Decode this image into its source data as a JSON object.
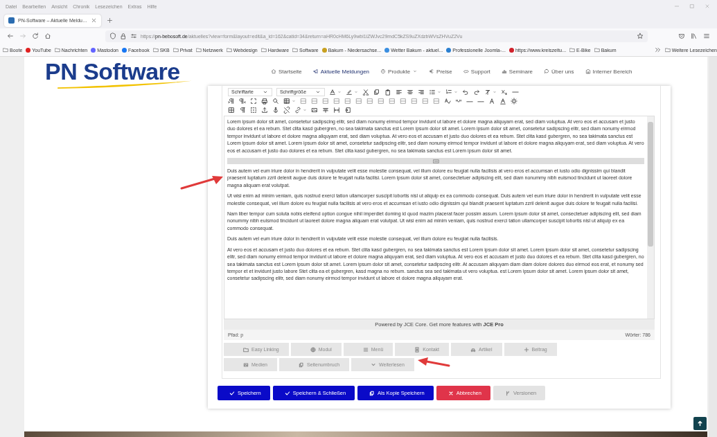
{
  "browser": {
    "menu": [
      "Datei",
      "Bearbeiten",
      "Ansicht",
      "Chronik",
      "Lesezeichen",
      "Extras",
      "Hilfe"
    ],
    "tab": {
      "title": "PN-Software – Aktuelle Meldu…"
    },
    "url": {
      "scheme": "https://",
      "host": "pn-bebosoft.de",
      "path": "/aktuelles?view=form&layout=edit&a_id=162&catid=34&return=aHR0cHM6Ly9wbi1iZWJvc29mdC5kZS9uZXdzbWVsZHVuZ2Vu"
    },
    "bookmarks": [
      {
        "label": "Boote",
        "kind": "folder"
      },
      {
        "label": "YouTube",
        "kind": "favicon",
        "color": "#e02020"
      },
      {
        "label": "Nachrichten",
        "kind": "folder"
      },
      {
        "label": "Mastodon",
        "kind": "favicon",
        "color": "#6364ff"
      },
      {
        "label": "Facebook",
        "kind": "favicon",
        "color": "#1877f2"
      },
      {
        "label": "SKB",
        "kind": "folder"
      },
      {
        "label": "Privat",
        "kind": "folder"
      },
      {
        "label": "Netzwerk",
        "kind": "folder"
      },
      {
        "label": "Webdesign",
        "kind": "folder"
      },
      {
        "label": "Hardware",
        "kind": "folder"
      },
      {
        "label": "Software",
        "kind": "folder"
      },
      {
        "label": "Bakum - Niedersachse...",
        "kind": "favicon",
        "color": "#c8a020"
      },
      {
        "label": "Wetter Bakum - aktuel...",
        "kind": "favicon",
        "color": "#3a8ee0"
      },
      {
        "label": "Professionelle Joomla-...",
        "kind": "favicon",
        "color": "#2a7fd0"
      },
      {
        "label": "https://www.kreiszeitu...",
        "kind": "favicon",
        "color": "#d0202a"
      },
      {
        "label": "E-Bike",
        "kind": "folder"
      },
      {
        "label": "Bakum",
        "kind": "folder"
      }
    ],
    "other_bookmarks": "Weitere Lesezeichen"
  },
  "site": {
    "logo": "PN Software",
    "nav": [
      {
        "label": "Startseite",
        "selected": false,
        "dropdown": false
      },
      {
        "label": "Aktuelle Meldungen",
        "selected": true,
        "dropdown": false
      },
      {
        "label": "Produkte",
        "selected": false,
        "dropdown": true
      },
      {
        "label": "Preise",
        "selected": false,
        "dropdown": false
      },
      {
        "label": "Support",
        "selected": false,
        "dropdown": false
      },
      {
        "label": "Seminare",
        "selected": false,
        "dropdown": false
      },
      {
        "label": "Über uns",
        "selected": false,
        "dropdown": false
      },
      {
        "label": "Interner Bereich",
        "selected": false,
        "dropdown": false
      }
    ]
  },
  "editor": {
    "font_selects": [
      "Schriftarte",
      "Schriftgröße"
    ],
    "content": [
      {
        "kind": "text",
        "text": "Lorem ipsum dolor sit amet, consetetur sadipscing elitr, sed diam nonumy eirmod tempor invidunt ut labore et dolore magna aliquyam erat, sed diam voluptua. At vero eos et accusam et justo duo dolores et ea rebum. Stet clita kasd gubergren, no sea takimata sanctus est Lorem ipsum dolor sit amet. Lorem ipsum dolor sit amet, consetetur sadipscing elitr, sed diam nonumy eirmod tempor invidunt ut labore et dolore magna aliquyam erat, sed diam voluptua. At vero eos et accusam et justo duo dolores et ea rebum. Stet clita kasd gubergren, no sea takimata sanctus est Lorem ipsum dolor sit amet. Lorem ipsum dolor sit amet, consetetur sadipscing elitr, sed diam nonumy eirmod tempor invidunt ut labore et dolore magna aliquyam erat, sed diam voluptua. At vero eos et accusam et justo duo dolores et ea rebum. Stet clita kasd gubergren, no sea takimata sanctus est Lorem ipsum dolor sit amet."
      },
      {
        "kind": "readmore"
      },
      {
        "kind": "text",
        "text": "Duis autem vel eum iriure dolor in hendrerit in vulputate velit esse molestie consequat, vel illum dolore eu feugiat nulla facilisis at vero eros et accumsan et iusto odio dignissim qui blandit praesent luptatum zzril delenit augue duis dolore te feugait nulla facilisi. Lorem ipsum dolor sit amet, consectetuer adipiscing elit, sed diam nonummy nibh euismod tincidunt ut laoreet dolore magna aliquam erat volutpat."
      },
      {
        "kind": "text",
        "text": "Ut wisi enim ad minim veniam, quis nostrud exerci tation ullamcorper suscipit lobortis nisl ut aliquip ex ea commodo consequat. Duis autem vel eum iriure dolor in hendrerit in vulputate velit esse molestie consequat, vel illum dolore eu feugiat nulla facilisis at vero eros et accumsan et iusto odio dignissim qui blandit praesent luptatum zzril delenit augue duis dolore te feugait nulla facilisi."
      },
      {
        "kind": "text",
        "text": "Nam liber tempor cum soluta nobis eleifend option congue nihil imperdiet doming id quod mazim placerat facer possim assum. Lorem ipsum dolor sit amet, consectetuer adipiscing elit, sed diam nonummy nibh euismod tincidunt ut laoreet dolore magna aliquam erat volutpat. Ut wisi enim ad minim veniam, quis nostrud exerci tation ullamcorper suscipit lobortis nisl ut aliquip ex ea commodo consequat."
      },
      {
        "kind": "text",
        "text": "Duis autem vel eum iriure dolor in hendrerit in vulputate velit esse molestie consequat, vel illum dolore eu feugiat nulla facilisis."
      },
      {
        "kind": "text",
        "text": "At vero eos et accusam et justo duo dolores et ea rebum. Stet clita kasd gubergren, no sea takimata sanctus est Lorem ipsum dolor sit amet. Lorem ipsum dolor sit amet, consetetur sadipscing elitr, sed diam nonumy eirmod tempor invidunt ut labore et dolore magna aliquyam erat, sed diam voluptua. At vero eos et accusam et justo duo dolores et ea rebum. Stet clita kasd gubergren, no sea takimata sanctus est Lorem ipsum dolor sit amet. Lorem ipsum dolor sit amet, consetetur sadipscing elitr. At accusam aliquyam diam diam dolore dolores duo eirmod eos erat, et nonumy sed tempor et et invidunt justo labore Stet clita ea et gubergren, kasd magna no rebum. sanctus sea sed takimata ut vero voluptua. est Lorem ipsum dolor sit amet. Lorem ipsum dolor sit amet, consetetur sadipscing elitr, sed diam nonumy eirmod tempor invidunt ut labore et dolore magna aliquyam erat."
      }
    ],
    "powered": "Powered by JCE Core. Get more features with **JCE Pro**",
    "path": "Pfad: p",
    "words": "Wörter: 786"
  },
  "insert_buttons": [
    {
      "label": "Easy Linking",
      "disabled": true
    },
    {
      "label": "Modul",
      "disabled": true
    },
    {
      "label": "Menü",
      "disabled": true
    },
    {
      "label": "Kontakt",
      "disabled": true
    },
    {
      "label": "Artikel",
      "disabled": true
    },
    {
      "label": "Beitrag",
      "disabled": true
    },
    {
      "label": "Medien",
      "disabled": true
    },
    {
      "label": "Seitenumbruch",
      "disabled": true
    },
    {
      "label": "Weiterlesen",
      "disabled": true
    }
  ],
  "actions": [
    {
      "label": "Speichern",
      "kind": "primary",
      "disabled": false
    },
    {
      "label": "Speichern & Schließen",
      "kind": "primary",
      "disabled": false
    },
    {
      "label": "Als Kopie Speichern",
      "kind": "primary",
      "disabled": false
    },
    {
      "label": "Abbrechen",
      "kind": "danger",
      "disabled": false
    },
    {
      "label": "Versionen",
      "kind": "primary",
      "disabled": true
    }
  ]
}
